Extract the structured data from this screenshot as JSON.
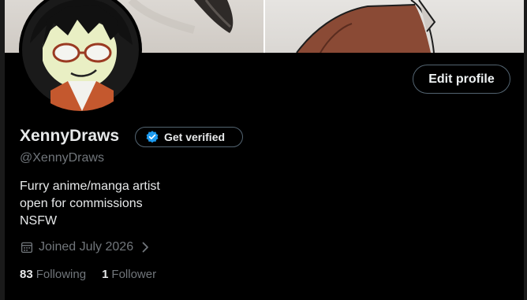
{
  "profile": {
    "display_name": "XennyDraws",
    "handle": "@XennyDraws",
    "verify_label": "Get verified",
    "edit_label": "Edit profile",
    "bio": [
      "Furry anime/manga artist",
      "open for commissions",
      "NSFW"
    ],
    "joined": "Joined July 2026",
    "following_count": "83",
    "following_label": "Following",
    "follower_count": "1",
    "follower_label": "Follower"
  },
  "colors": {
    "background": "#000000",
    "text_primary": "#e7e9ea",
    "text_secondary": "#71767b",
    "border": "#536471",
    "verified_blue": "#1d9bf0"
  },
  "icons": {
    "verified": "verified-badge-icon",
    "calendar": "calendar-icon",
    "chevron": "chevron-right-icon"
  }
}
